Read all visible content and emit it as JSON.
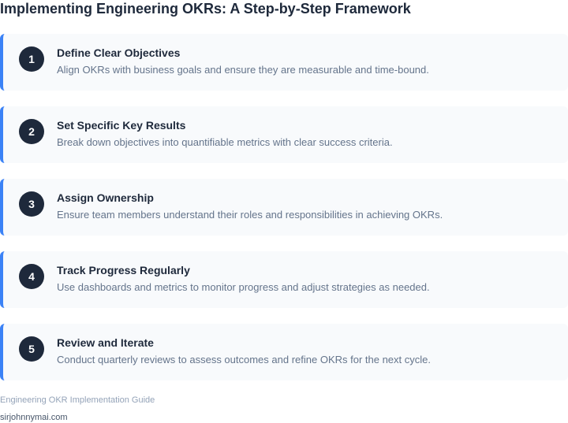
{
  "page": {
    "title": "Implementing Engineering OKRs: A Step-by-Step Framework"
  },
  "steps": [
    {
      "number": "1",
      "title": "Define Clear Objectives",
      "description": "Align OKRs with business goals and ensure they are measurable and time-bound."
    },
    {
      "number": "2",
      "title": "Set Specific Key Results",
      "description": "Break down objectives into quantifiable metrics with clear success criteria."
    },
    {
      "number": "3",
      "title": "Assign Ownership",
      "description": "Ensure team members understand their roles and responsibilities in achieving OKRs."
    },
    {
      "number": "4",
      "title": "Track Progress Regularly",
      "description": "Use dashboards and metrics to monitor progress and adjust strategies as needed."
    },
    {
      "number": "5",
      "title": "Review and Iterate",
      "description": "Conduct quarterly reviews to assess outcomes and refine OKRs for the next cycle."
    }
  ],
  "footer": {
    "title": "Engineering OKR Implementation Guide",
    "site": "sirjohnnymai.com"
  },
  "colors": {
    "accent": "#3b82f6",
    "badge": "#1e293b",
    "card_background": "#f8fafc"
  }
}
